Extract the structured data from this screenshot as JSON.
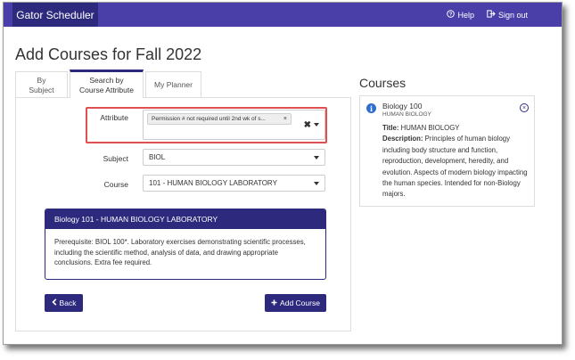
{
  "navbar": {
    "brand": "Gator Scheduler",
    "help_label": "Help",
    "signout_label": "Sign out"
  },
  "page": {
    "title": "Add Courses for Fall 2022"
  },
  "tabs": [
    {
      "label": "By Subject"
    },
    {
      "label": "Search by Course Attribute"
    },
    {
      "label": "My Planner"
    }
  ],
  "form": {
    "attribute_label": "Attribute",
    "attribute_chip": "Permission # not required until 2nd wk of s...",
    "subject_label": "Subject",
    "subject_value": "BIOL",
    "course_label": "Course",
    "course_value": "101 - HUMAN BIOLOGY LABORATORY"
  },
  "description": {
    "heading": "Biology 101 - HUMAN BIOLOGY LABORATORY",
    "text": "Prerequisite: BIOL 100*. Laboratory exercises demonstrating scientific processes, including the scientific method, analysis of data, and drawing appropriate conclusions. Extra fee required."
  },
  "buttons": {
    "back_label": "Back",
    "add_label": "Add Course"
  },
  "courses": {
    "title": "Courses",
    "items": [
      {
        "name": "Biology 100",
        "subtitle": "HUMAN BIOLOGY",
        "title_label": "Title:",
        "title_value": "HUMAN BIOLOGY",
        "desc_label": "Description:",
        "desc_value": "Principles of human biology including body structure and function, reproduction, development, heredity, and evolution. Aspects of modern biology impacting the human species. Intended for non-Biology majors."
      }
    ]
  },
  "colors": {
    "navbar": "#4a3fa8",
    "brand": "#2d2a7e",
    "primary_button": "#2d2a7e",
    "highlight": "#e05050"
  }
}
